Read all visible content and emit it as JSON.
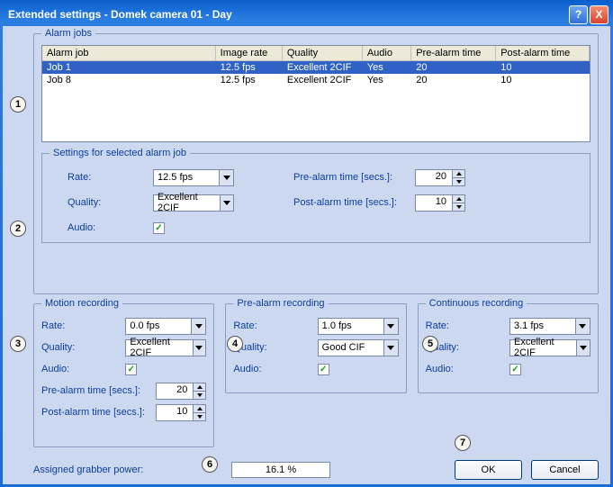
{
  "title": "Extended settings - Domek camera 01 - Day",
  "titlebar": {
    "help": "?",
    "close": "X"
  },
  "markers": {
    "m1": "1",
    "m2": "2",
    "m3": "3",
    "m4": "4",
    "m5": "5",
    "m6": "6",
    "m7": "7"
  },
  "alarmjobs": {
    "legend": "Alarm jobs",
    "cols": [
      "Alarm job",
      "Image rate",
      "Quality",
      "Audio",
      "Pre-alarm time",
      "Post-alarm time"
    ],
    "rows": [
      {
        "name": "Job  1",
        "rate": "12.5 fps",
        "quality": "Excellent 2CIF",
        "audio": "Yes",
        "pre": "20",
        "post": "10",
        "sel": true
      },
      {
        "name": "Job  8",
        "rate": "12.5 fps",
        "quality": "Excellent 2CIF",
        "audio": "Yes",
        "pre": "20",
        "post": "10",
        "sel": false
      }
    ]
  },
  "settings": {
    "legend": "Settings for selected alarm job",
    "rate_l": "Rate:",
    "rate_v": "12.5 fps",
    "quality_l": "Quality:",
    "quality_v": "Excellent 2CIF",
    "audio_l": "Audio:",
    "audio_v": true,
    "pre_l": "Pre-alarm time [secs.]:",
    "pre_v": "20",
    "post_l": "Post-alarm time [secs.]:",
    "post_v": "10"
  },
  "motion": {
    "legend": "Motion recording",
    "rate_l": "Rate:",
    "rate_v": "0.0 fps",
    "quality_l": "Quality:",
    "quality_v": "Excellent 2CIF",
    "audio_l": "Audio:",
    "audio_v": true,
    "pre_l": "Pre-alarm time [secs.]:",
    "pre_v": "20",
    "post_l": "Post-alarm time [secs.]:",
    "post_v": "10"
  },
  "prealarm": {
    "legend": "Pre-alarm recording",
    "rate_l": "Rate:",
    "rate_v": "1.0 fps",
    "quality_l": "Quality:",
    "quality_v": "Good CIF",
    "audio_l": "Audio:",
    "audio_v": true
  },
  "continuous": {
    "legend": "Continuous recording",
    "rate_l": "Rate:",
    "rate_v": "3.1 fps",
    "quality_l": "Quality:",
    "quality_v": "Excellent 2CIF",
    "audio_l": "Audio:",
    "audio_v": true
  },
  "bottom": {
    "grabber_l": "Assigned grabber power:",
    "grabber_v": "16.1 %",
    "ok": "OK",
    "cancel": "Cancel"
  }
}
